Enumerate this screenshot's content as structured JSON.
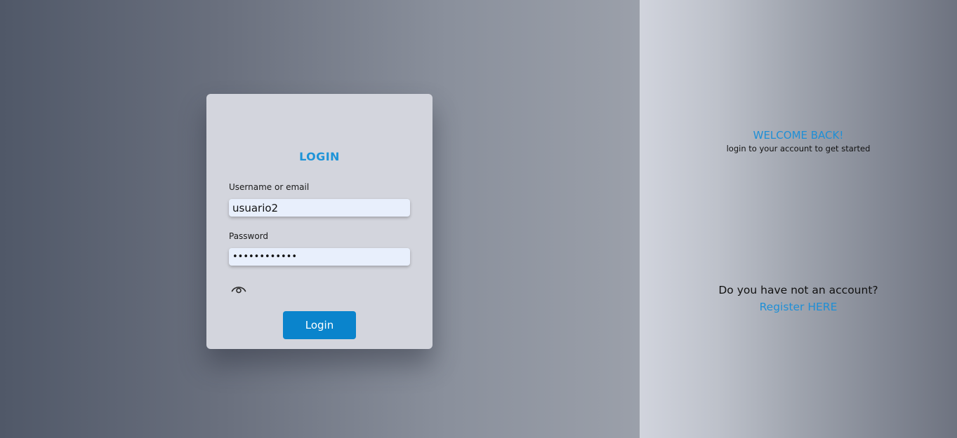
{
  "login_card": {
    "title": "LOGIN",
    "username_label": "Username or email",
    "username_value": "usuario2",
    "password_label": "Password",
    "password_value": "passwordxxxx",
    "show_password_icon": "eye-icon",
    "login_button": "Login"
  },
  "welcome_panel": {
    "title": "WELCOME BACK!",
    "subtitle": "login to your account to get started",
    "no_account_text": "Do you have not an account?",
    "register_link": "Register HERE"
  },
  "colors": {
    "accent": "#1e94d8",
    "button": "#0a84cc",
    "card_background": "#d3d5dd",
    "input_background": "#e8effc"
  }
}
